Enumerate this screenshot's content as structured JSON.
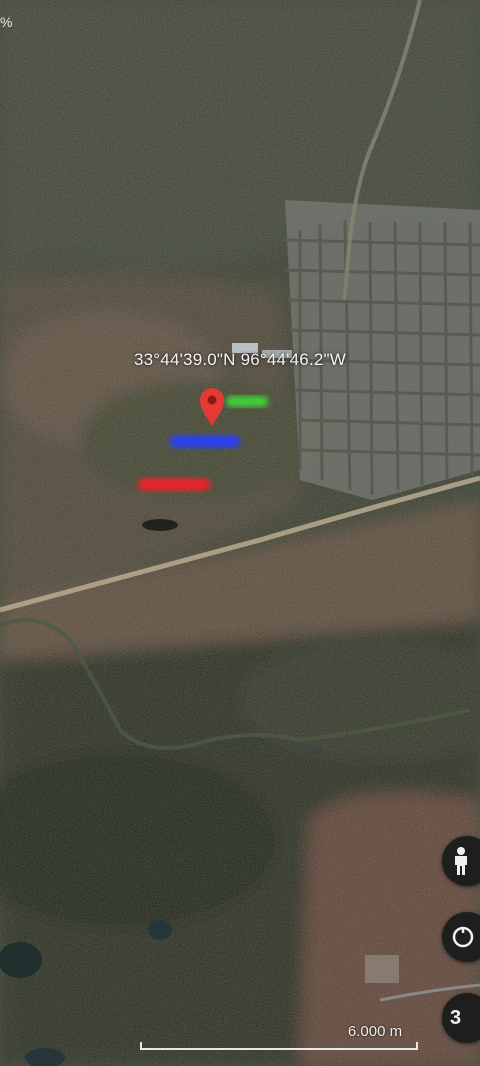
{
  "status": {
    "battery_fragment": "%"
  },
  "map": {
    "coordinate_label": "33°44'39.0\"N 96°44'46.2\"W",
    "markers": [
      {
        "name": "green-marker",
        "color": "#3fd13a"
      },
      {
        "name": "blue-marker",
        "color": "#2a3ff0"
      },
      {
        "name": "red-marker",
        "color": "#e8202a"
      }
    ],
    "pin_color": "#e53935"
  },
  "controls": {
    "pegman_icon": "pegman-icon",
    "layers_icon": "layers-icon",
    "third_button_label": "3"
  },
  "scale": {
    "label": "6.000 m"
  }
}
